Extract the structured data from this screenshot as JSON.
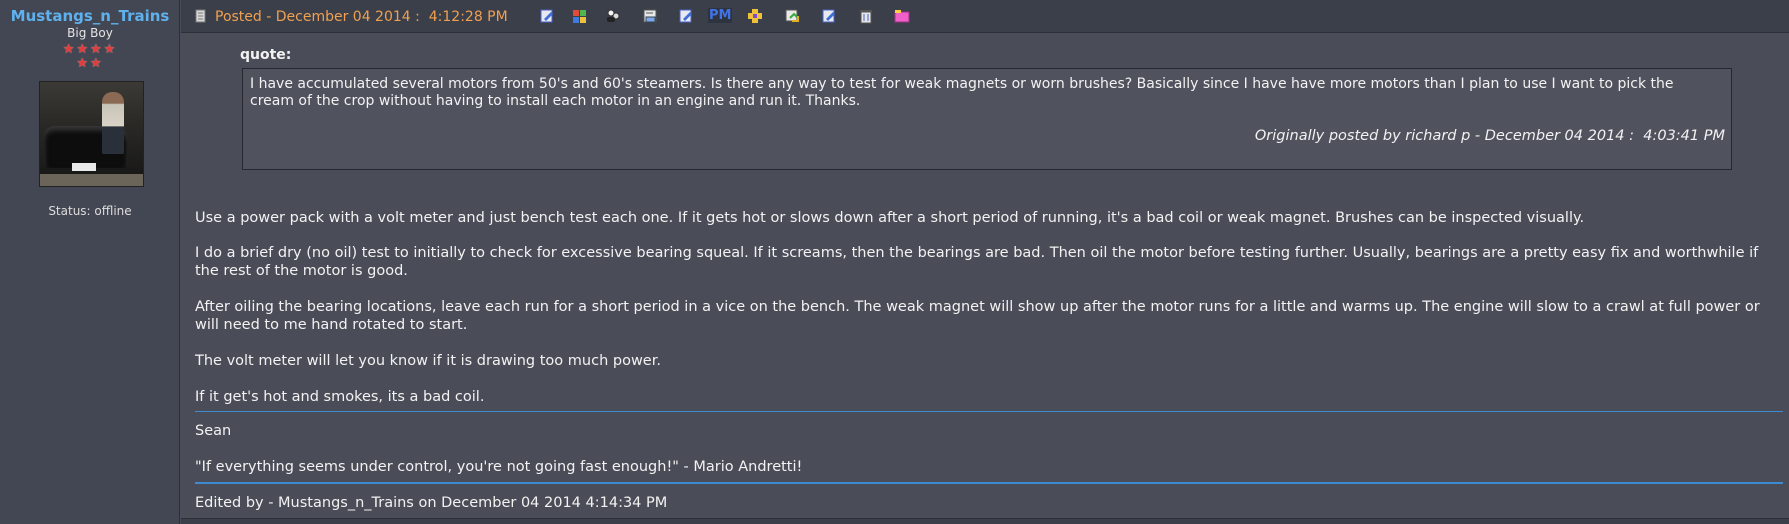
{
  "user": {
    "name": "Mustangs_n_Trains",
    "rank": "Big Boy",
    "stars": "★★★★",
    "stars2": "★★",
    "status": "Status: offline"
  },
  "header": {
    "posted": "Posted - December 04 2014 :  4:12:28 PM",
    "pm_label": "PM"
  },
  "quote": {
    "label": "quote:",
    "text": "I have accumulated several motors from 50's and 60's steamers. Is there any way to test for weak magnets or worn brushes? Basically since I have have more motors than I plan to use I want to pick the cream of the crop without having to install each motor in an engine and run it. Thanks.",
    "attribution": "Originally posted by richard p - December 04 2014 :  4:03:41 PM"
  },
  "body": {
    "p1": "Use a power pack with a volt meter and just bench test each one. If it gets hot or slows down after a short period of running, it's a bad coil or weak magnet. Brushes can be inspected visually.",
    "p2": "I do a brief dry (no oil) test to initially to check for excessive bearing squeal. If it screams, then the bearings are bad. Then oil the motor before testing further. Usually, bearings are a pretty easy fix and worthwhile if the rest of the motor is good.",
    "p3": "After oiling the bearing locations, leave each run for a short period in a vice on the bench. The weak magnet will show up after the motor runs for a little and warms up. The engine will slow to a crawl at full power or will need to me hand rotated to start.",
    "p4": "The volt meter will let you know if it is drawing too much power.",
    "p5": "If it get's hot and smokes, its a bad coil."
  },
  "signature": {
    "name": "Sean",
    "quote": "\"If everything seems under control, you're not going fast enough!\" - Mario Andretti!"
  },
  "edited": "Edited by - Mustangs_n_Trains on December 04 2014 4:14:34 PM",
  "icons": [
    "profile-icon",
    "homepage-icon",
    "buddy-icon",
    "email-icon",
    "edit-icon",
    "pm-icon",
    "quote-icon",
    "reply-icon",
    "edit-post-icon",
    "delete-icon",
    "folder-icon"
  ],
  "colors": {
    "username": "#5fb1ee",
    "posted": "#f0a050",
    "separator": "#3e8ad0",
    "background": "#4a4d58"
  }
}
